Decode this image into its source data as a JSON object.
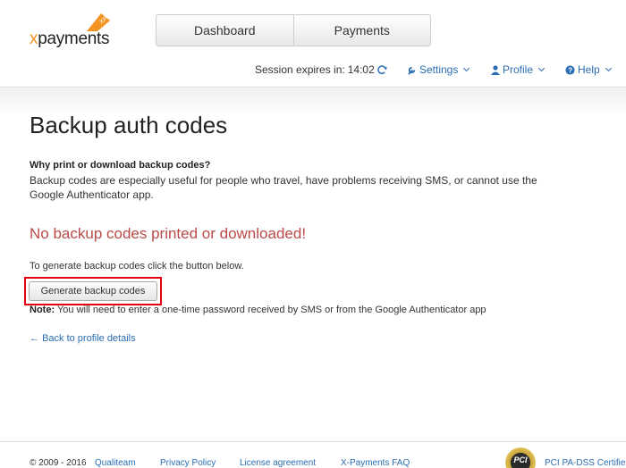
{
  "header": {
    "logo": {
      "x": "x",
      "rest": "payments",
      "badge": "XP"
    },
    "nav": [
      "Dashboard",
      "Payments"
    ],
    "session_label": "Session expires in:",
    "session_time": "14:02",
    "settings": "Settings",
    "profile": "Profile",
    "help": "Help"
  },
  "main": {
    "title": "Backup auth codes",
    "question": "Why print or download backup codes?",
    "explanation": "Backup codes are especially useful for people who travel, have problems receiving SMS, or cannot use the Google Authenticator app.",
    "alert": "No backup codes printed or downloaded!",
    "instruction": "To generate backup codes click the button below.",
    "button_label": "Generate backup codes",
    "note_label": "Note:",
    "note_text": "You will need to enter a one-time password received by SMS or from the Google Authenticator app",
    "back_arrow": "←",
    "back_link": "Back to profile details"
  },
  "footer": {
    "copyright": "© 2009 - 2016",
    "company": "Qualiteam",
    "privacy": "Privacy Policy",
    "license": "License agreement",
    "faq": "X-Payments FAQ",
    "pci_badge": "PCI",
    "pci_text": "PCI PA-DSS Certifie"
  },
  "colors": {
    "accent": "#f39321",
    "link": "#2a6db3",
    "alert": "#b94a48",
    "highlight": "#e3000f"
  }
}
